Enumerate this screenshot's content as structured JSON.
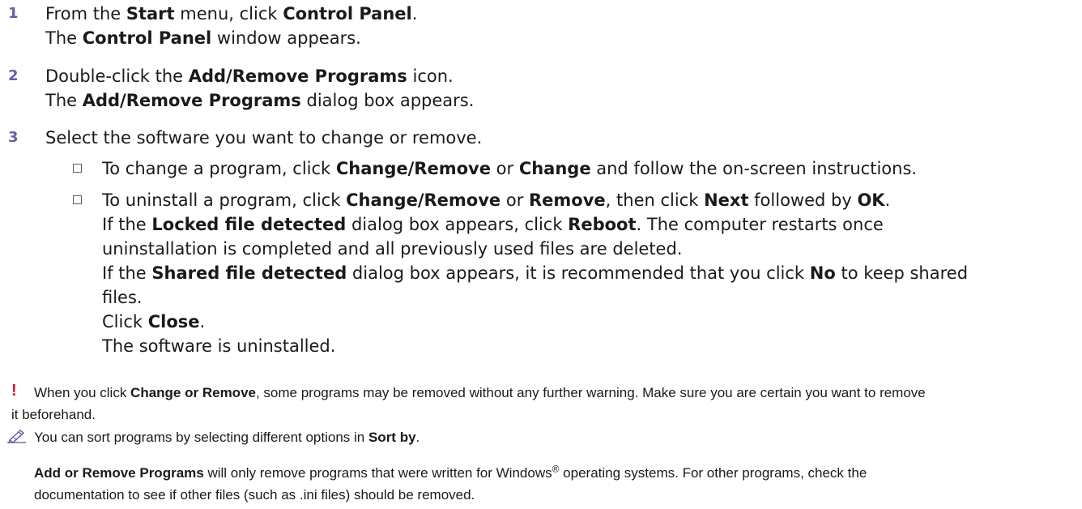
{
  "steps": [
    {
      "number": "1",
      "line1": {
        "pre": "From the ",
        "b1": "Start",
        "mid": " menu, click ",
        "b2": "Control Panel",
        "post": "."
      },
      "line2": {
        "pre": "The ",
        "b1": "Control Panel",
        "post": " window appears."
      }
    },
    {
      "number": "2",
      "line1": {
        "pre": "Double-click the ",
        "b1": "Add/Remove Programs",
        "post": " icon."
      },
      "line2": {
        "pre": "The ",
        "b1": "Add/Remove Programs",
        "post": " dialog box appears."
      }
    },
    {
      "number": "3",
      "line1": {
        "text": "Select the software you want to change or remove."
      }
    }
  ],
  "bullets": {
    "change": {
      "pre": "To change a program, click ",
      "b1": "Change/Remove",
      "mid": " or ",
      "b2": "Change",
      "post": " and follow the on-screen instructions."
    },
    "uninstall": {
      "line1": {
        "pre": "To uninstall a program, click ",
        "b1": "Change/Remove",
        "m1": " or ",
        "b2": "Remove",
        "m2": ", then click ",
        "b3": "Next",
        "m3": " followed by ",
        "b4": "OK",
        "post": "."
      },
      "line2": {
        "pre": "If the ",
        "b1": "Locked file detected",
        "mid": " dialog box appears, click ",
        "b2": "Reboot",
        "post": ". The computer restarts once"
      },
      "line3": "uninstallation is completed and all previously used files are deleted.",
      "line4": {
        "pre": "If the ",
        "b1": "Shared file detected",
        "mid": " dialog box appears, it is recommended that you click ",
        "b2": "No",
        "post": " to keep shared"
      },
      "line5": "files.",
      "line6": {
        "pre": "Click ",
        "b1": "Close",
        "post": "."
      },
      "line7": "The software is uninstalled."
    }
  },
  "warning": {
    "symbol": "!",
    "line1": {
      "pre": "When you click ",
      "b1": "Change or Remove",
      "post": ", some programs may be removed without any further warning. Make sure you are certain you want to remove"
    },
    "line2": "it beforehand."
  },
  "tip": {
    "pre": "You can sort programs by selecting different options in ",
    "b1": "Sort by",
    "post": "."
  },
  "note2": {
    "line1": {
      "b1": "Add or Remove Programs",
      "pre": " will only remove programs that were written for Windows",
      "sup": "®",
      "post": " operating systems. For other programs, check the"
    },
    "line2": "documentation to see if other files (such as .ini files) should be removed."
  },
  "colors": {
    "step_number": "#6b5ea8",
    "warning": "#d8112e",
    "tip_icon": "#5b4fa0"
  },
  "icons": {
    "checkbox": "checkbox-icon",
    "warning": "exclamation-icon",
    "tip": "pen-note-icon"
  }
}
